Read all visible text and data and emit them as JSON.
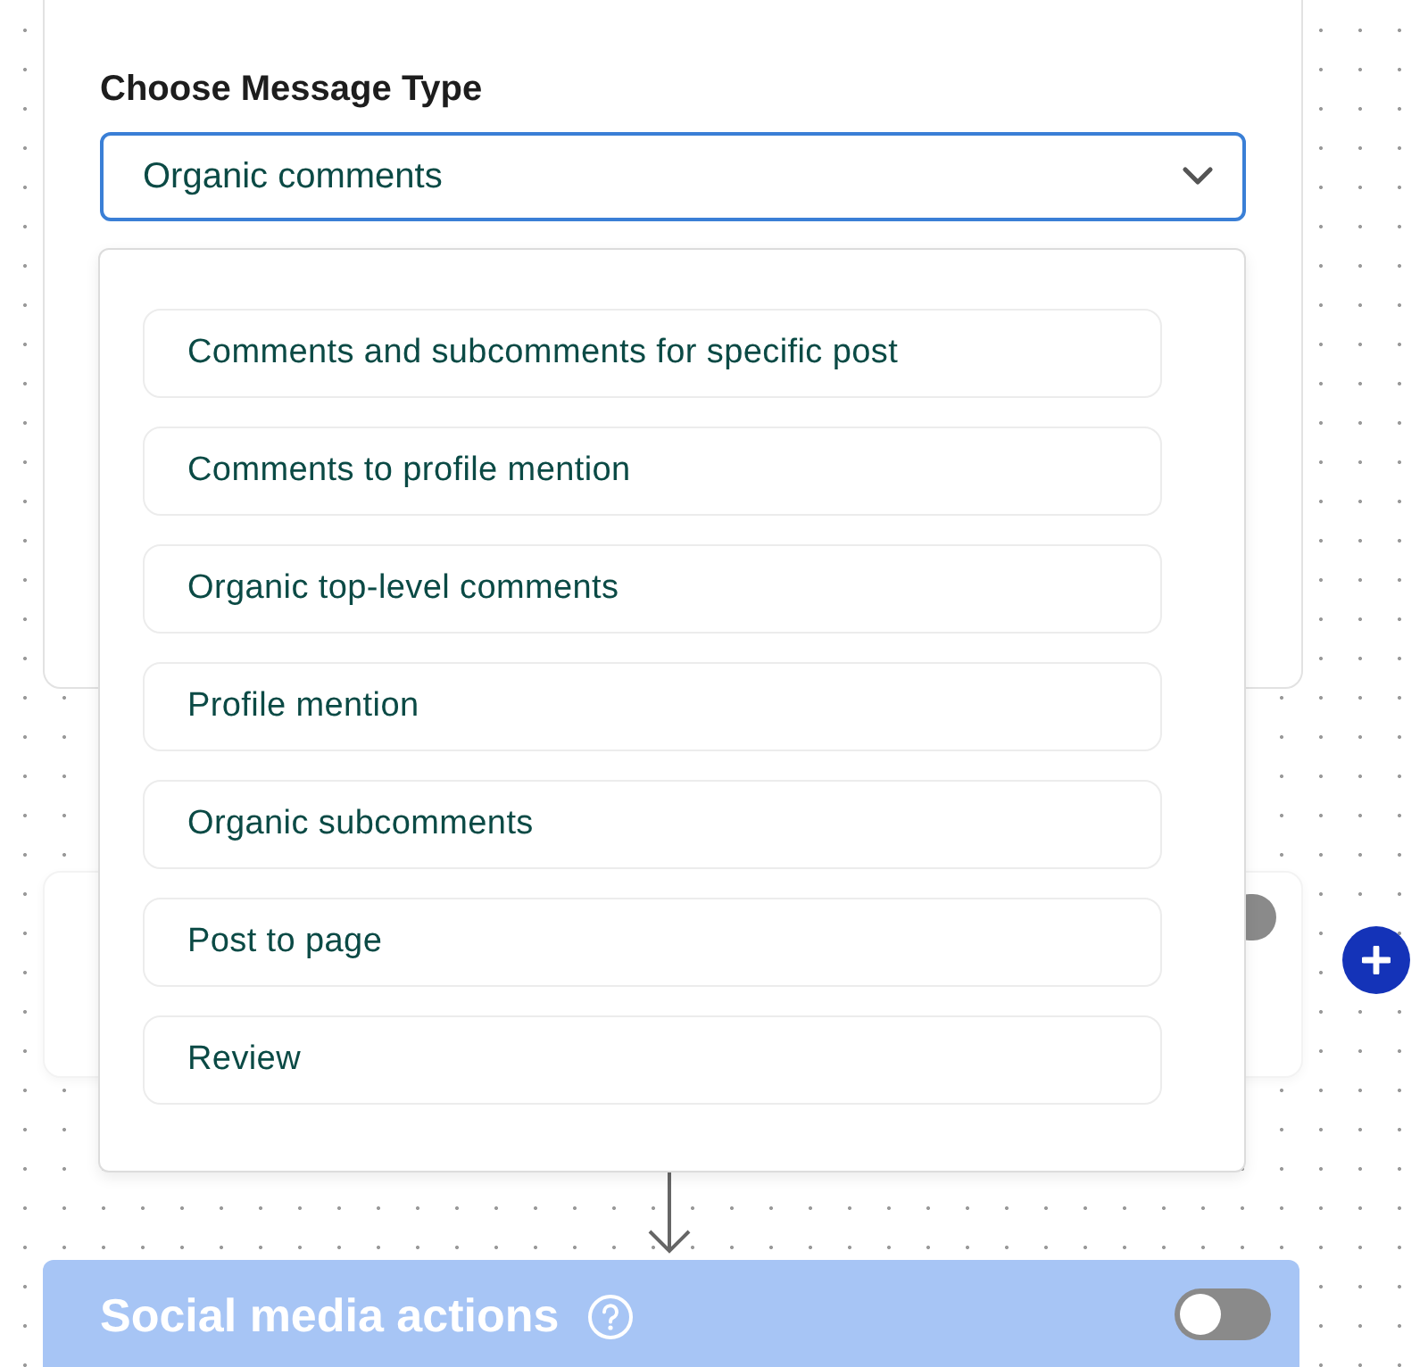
{
  "message_type": {
    "label": "Choose Message Type",
    "value": "Organic comments",
    "focused": true,
    "expanded": true,
    "options": [
      {
        "label": "Comments and subcomments for specific post",
        "selected": false
      },
      {
        "label": "Comments to profile mention",
        "selected": false
      },
      {
        "label": "Organic top-level comments",
        "selected": false
      },
      {
        "label": "Profile mention",
        "selected": false
      },
      {
        "label": "Organic subcomments",
        "selected": false
      },
      {
        "label": "Post to page",
        "selected": false
      },
      {
        "label": "Review",
        "selected": false
      }
    ]
  },
  "hidden_card": {
    "toggle_on": false
  },
  "social_actions": {
    "title": "Social media actions",
    "enabled": false
  }
}
